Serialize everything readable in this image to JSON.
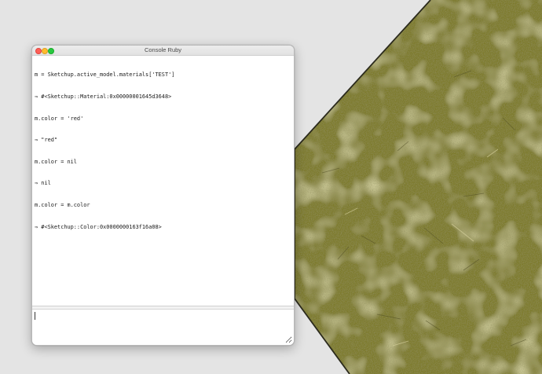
{
  "window": {
    "title": "Console Ruby"
  },
  "console": {
    "lines": [
      "m = Sketchup.active_model.materials['TEST']",
      "⇒ #<Sketchup::Material:0x00000001645d3648>",
      "m.color = 'red'",
      "⇒ \"red\"",
      "m.color = nil",
      "⇒ nil",
      "m.color = m.color",
      "⇒ #<Sketchup::Color:0x0000000163f16a08>"
    ],
    "input_value": ""
  },
  "colors": {
    "background": "#e4e4e4",
    "terrain": "#7d7a2c",
    "close": "#fe5f57",
    "minimize": "#febc2e",
    "maximize": "#28c840"
  }
}
